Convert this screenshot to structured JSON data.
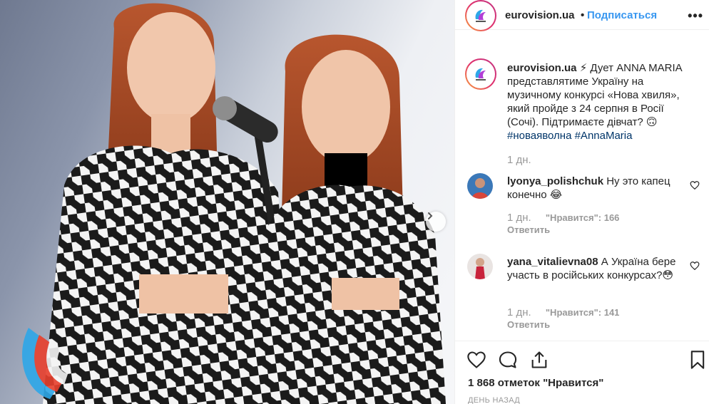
{
  "post": {
    "account": "eurovision.ua",
    "dot": "•",
    "follow_label": "Подписаться",
    "more_label": "•••",
    "caption_text": "⚡ Дует ANNA MARIA представлятиме Україну на музичному конкурсі «Нова хвиля», який пройде з 24 серпня в Росії (Сочі). Підтримаєте дівчат? 🙃",
    "hashtags": "#новаяволна #AnnaMaria",
    "caption_time": "1 дн."
  },
  "comments": [
    {
      "user": "lyonya_polishchuk",
      "text": "Ну это капец конечно 😂",
      "time": "1 дн.",
      "likes": "\"Нравится\": 166",
      "reply_label": "Ответить"
    },
    {
      "user": "yana_vitalievna08",
      "text": "А Україна бере участь в російських конкурсах?😳",
      "time": "1 дн.",
      "likes": "\"Нравится\": 141",
      "reply_label": "Ответить"
    }
  ],
  "footer": {
    "likes_total": "1 868 отметок \"Нравится\"",
    "posted_ago": "ДЕНЬ НАЗАД"
  },
  "icons": {
    "like": "heart-icon",
    "comment": "comment-icon",
    "share": "share-icon",
    "save": "bookmark-icon",
    "next": "chevron-right-icon"
  },
  "colors": {
    "link": "#3897f0",
    "hashtag": "#003569",
    "muted": "#999999",
    "text": "#262626"
  }
}
